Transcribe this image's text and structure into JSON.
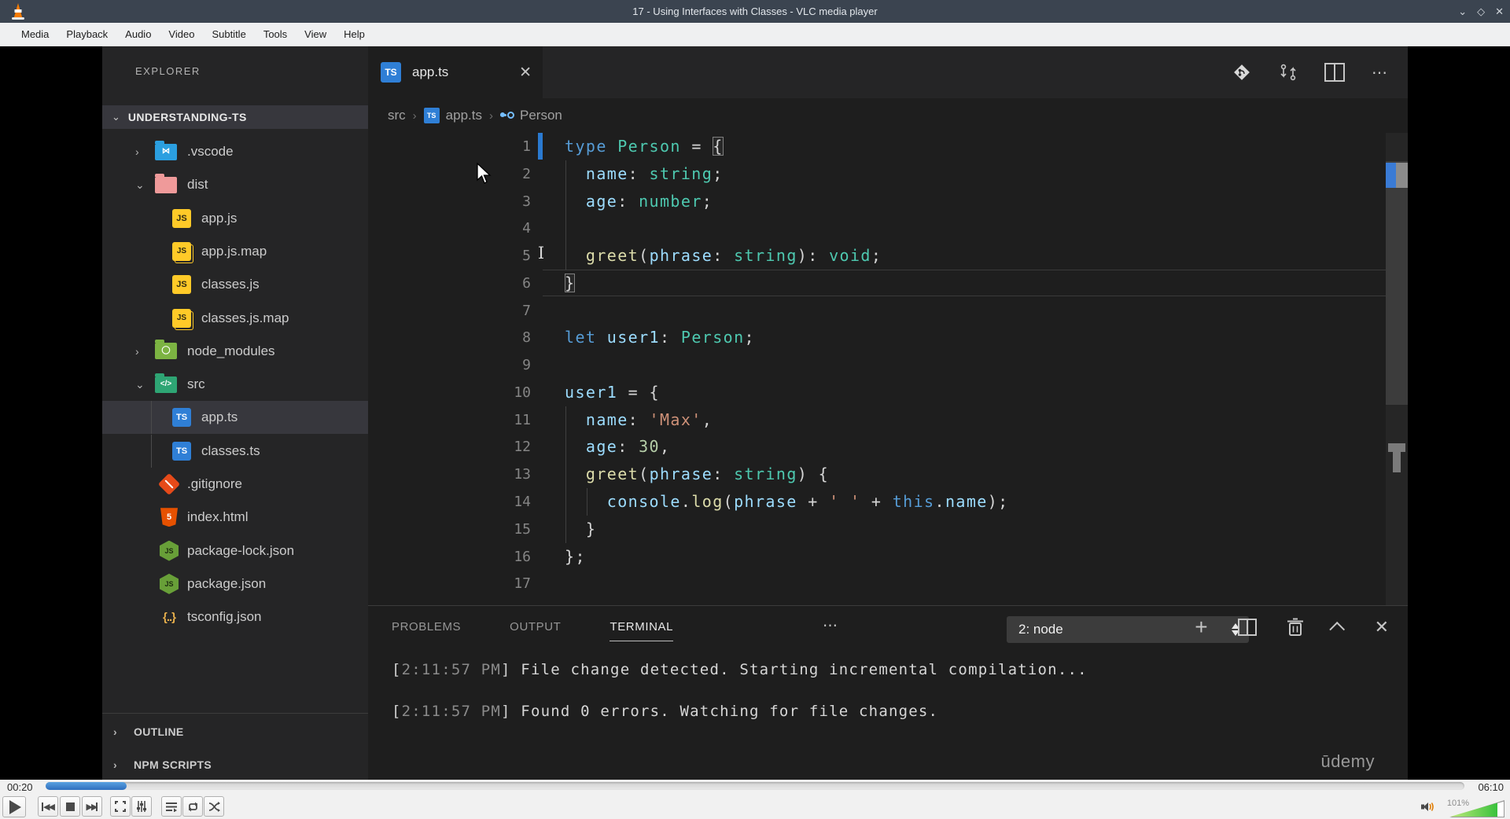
{
  "vlc": {
    "title": "17 - Using Interfaces with Classes - VLC media player",
    "menu": [
      "Media",
      "Playback",
      "Audio",
      "Video",
      "Subtitle",
      "Tools",
      "View",
      "Help"
    ],
    "window_controls": {
      "minimize": "⌄",
      "maximize": "◇",
      "close": "✕"
    },
    "time_elapsed": "00:20",
    "time_total": "06:10",
    "progress_pct": 5.7,
    "volume_label": "101%",
    "volume_pct": 86,
    "accent_blue": "#2f6fbe"
  },
  "vscode": {
    "explorer": {
      "title": "EXPLORER",
      "root": "UNDERSTANDING-TS",
      "items": [
        {
          "label": ".vscode",
          "icon": "folder-vscode",
          "chevron": "right",
          "indent": 1
        },
        {
          "label": "dist",
          "icon": "folder-dist",
          "chevron": "down",
          "indent": 1
        },
        {
          "label": "app.js",
          "icon": "js",
          "indent": 2
        },
        {
          "label": "app.js.map",
          "icon": "jsmap",
          "indent": 2
        },
        {
          "label": "classes.js",
          "icon": "js",
          "indent": 2
        },
        {
          "label": "classes.js.map",
          "icon": "jsmap",
          "indent": 2
        },
        {
          "label": "node_modules",
          "icon": "folder-node",
          "chevron": "right",
          "indent": 1
        },
        {
          "label": "src",
          "icon": "folder-src",
          "chevron": "down",
          "indent": 1
        },
        {
          "label": "app.ts",
          "icon": "ts",
          "indent": 2,
          "selected": true,
          "guide": true
        },
        {
          "label": "classes.ts",
          "icon": "ts",
          "indent": 2,
          "guide": true
        },
        {
          "label": ".gitignore",
          "icon": "git",
          "indent": 0
        },
        {
          "label": "index.html",
          "icon": "html",
          "indent": 0
        },
        {
          "label": "package-lock.json",
          "icon": "node",
          "indent": 0
        },
        {
          "label": "package.json",
          "icon": "node",
          "indent": 0
        },
        {
          "label": "tsconfig.json",
          "icon": "braces",
          "indent": 0
        }
      ],
      "sections": [
        "OUTLINE",
        "NPM SCRIPTS"
      ]
    },
    "tab": {
      "label": "app.ts",
      "close": "✕"
    },
    "breadcrumb": {
      "path": [
        "src",
        "app.ts"
      ],
      "symbol": "Person",
      "separator": "›"
    },
    "editor": {
      "current_line": 6,
      "lines": [
        {
          "n": 1,
          "tokens": [
            [
              "type",
              "kw"
            ],
            [
              " ",
              "pl"
            ],
            [
              "Person",
              "ty"
            ],
            [
              " = ",
              "pl"
            ],
            [
              "{",
              "pl",
              true
            ]
          ],
          "gitbar": true
        },
        {
          "n": 2,
          "tokens": [
            [
              "  ",
              "pl"
            ],
            [
              "name",
              "pr"
            ],
            [
              ": ",
              "pl"
            ],
            [
              "string",
              "ty"
            ],
            [
              ";",
              "pl"
            ]
          ],
          "guides": [
            0
          ]
        },
        {
          "n": 3,
          "tokens": [
            [
              "  ",
              "pl"
            ],
            [
              "age",
              "pr"
            ],
            [
              ": ",
              "pl"
            ],
            [
              "number",
              "ty"
            ],
            [
              ";",
              "pl"
            ]
          ],
          "guides": [
            0
          ]
        },
        {
          "n": 4,
          "tokens": [],
          "guides": [
            0
          ]
        },
        {
          "n": 5,
          "tokens": [
            [
              "  ",
              "pl"
            ],
            [
              "greet",
              "fn"
            ],
            [
              "(",
              "pl"
            ],
            [
              "phrase",
              "pr"
            ],
            [
              ": ",
              "pl"
            ],
            [
              "string",
              "ty"
            ],
            [
              "): ",
              "pl"
            ],
            [
              "void",
              "ty"
            ],
            [
              ";",
              "pl"
            ]
          ],
          "guides": [
            0
          ]
        },
        {
          "n": 6,
          "tokens": [
            [
              "}",
              "pl",
              true
            ]
          ]
        },
        {
          "n": 7,
          "tokens": []
        },
        {
          "n": 8,
          "tokens": [
            [
              "let",
              "kw"
            ],
            [
              " ",
              "pl"
            ],
            [
              "user1",
              "pr"
            ],
            [
              ": ",
              "pl"
            ],
            [
              "Person",
              "ty"
            ],
            [
              ";",
              "pl"
            ]
          ]
        },
        {
          "n": 9,
          "tokens": []
        },
        {
          "n": 10,
          "tokens": [
            [
              "user1",
              "pr"
            ],
            [
              " = {",
              "pl"
            ]
          ]
        },
        {
          "n": 11,
          "tokens": [
            [
              "  ",
              "pl"
            ],
            [
              "name",
              "pr"
            ],
            [
              ": ",
              "pl"
            ],
            [
              "'Max'",
              "st"
            ],
            [
              ",",
              "pl"
            ]
          ],
          "guides": [
            0
          ]
        },
        {
          "n": 12,
          "tokens": [
            [
              "  ",
              "pl"
            ],
            [
              "age",
              "pr"
            ],
            [
              ": ",
              "pl"
            ],
            [
              "30",
              "nu"
            ],
            [
              ",",
              "pl"
            ]
          ],
          "guides": [
            0
          ]
        },
        {
          "n": 13,
          "tokens": [
            [
              "  ",
              "pl"
            ],
            [
              "greet",
              "fn"
            ],
            [
              "(",
              "pl"
            ],
            [
              "phrase",
              "pr"
            ],
            [
              ": ",
              "pl"
            ],
            [
              "string",
              "ty"
            ],
            [
              ") {",
              "pl"
            ]
          ],
          "guides": [
            0
          ]
        },
        {
          "n": 14,
          "tokens": [
            [
              "    ",
              "pl"
            ],
            [
              "console",
              "pr"
            ],
            [
              ".",
              "pl"
            ],
            [
              "log",
              "fn"
            ],
            [
              "(",
              "pl"
            ],
            [
              "phrase",
              "pr"
            ],
            [
              " + ",
              "pl"
            ],
            [
              "' '",
              "st"
            ],
            [
              " + ",
              "pl"
            ],
            [
              "this",
              "kw"
            ],
            [
              ".",
              "pl"
            ],
            [
              "name",
              "pr"
            ],
            [
              ");",
              "pl"
            ]
          ],
          "guides": [
            0,
            1
          ]
        },
        {
          "n": 15,
          "tokens": [
            [
              "  }",
              "pl"
            ]
          ],
          "guides": [
            0
          ]
        },
        {
          "n": 16,
          "tokens": [
            [
              "};",
              "pl"
            ]
          ]
        },
        {
          "n": 17,
          "tokens": []
        }
      ]
    },
    "panel": {
      "tabs": [
        "PROBLEMS",
        "OUTPUT",
        "TERMINAL"
      ],
      "active_tab": "TERMINAL",
      "more": "⋯",
      "dropdown_value": "2: node",
      "terminal_lines": [
        {
          "timestamp": "2:11:57 PM",
          "message": "File change detected. Starting incremental compilation..."
        },
        {
          "timestamp": "2:11:57 PM",
          "message": "Found 0 errors. Watching for file changes."
        }
      ]
    },
    "watermark": "ūdemy"
  }
}
